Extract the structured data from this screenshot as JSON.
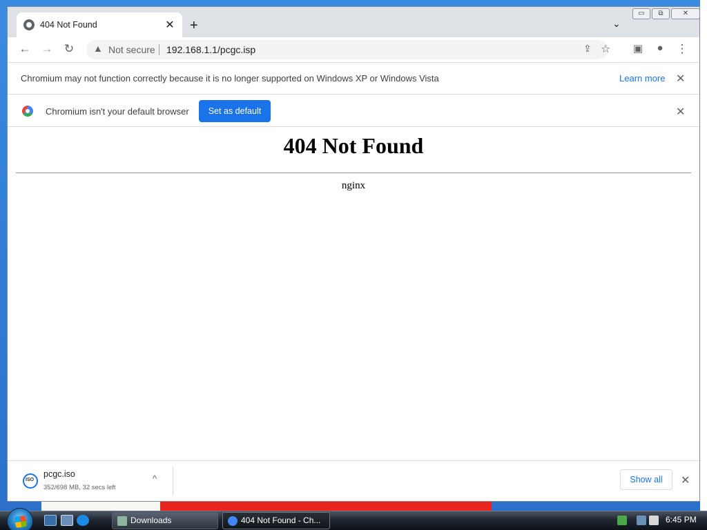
{
  "browser": {
    "tab_title": "404 Not Found",
    "tab_close": "✕",
    "new_tab": "+",
    "tab_search": "⌄",
    "window_controls": {
      "minimize": "▭",
      "restore": "⧉",
      "close": "✕"
    }
  },
  "toolbar": {
    "back": "←",
    "forward": "→",
    "reload": "↻",
    "security_label": "Not secure",
    "warning_glyph": "▲",
    "url": "192.168.1.1/pcgc.isp",
    "share": "⇪",
    "bookmark": "☆",
    "side_panel": "▣",
    "profile": "●",
    "menu": "⋮"
  },
  "infobar_unsupported": {
    "message": "Chromium may not function correctly because it is no longer supported on Windows XP or Windows Vista",
    "link": "Learn more",
    "close": "✕"
  },
  "infobar_default": {
    "message": "Chromium isn't your default browser",
    "button": "Set as default",
    "close": "✕"
  },
  "page": {
    "heading": "404 Not Found",
    "server": "nginx"
  },
  "download": {
    "filename": "pcgc.iso",
    "status": "352/698 MB, 32 secs left",
    "caret": "^",
    "show_all": "Show all",
    "close": "✕"
  },
  "taskbar": {
    "tasks": [
      {
        "label": "Downloads"
      },
      {
        "label": "404 Not Found - Ch..."
      }
    ],
    "clock": "6:45 PM"
  },
  "colors": {
    "accent": "#1a73e8",
    "tabstrip": "#dee1e6",
    "taskbar": "#1f2630"
  }
}
